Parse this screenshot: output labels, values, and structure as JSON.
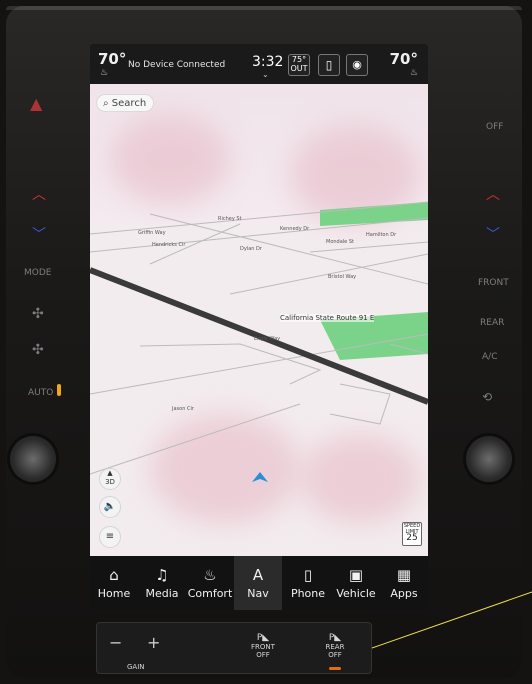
{
  "status_bar": {
    "temp_left": "70°",
    "device_status": "No Device Connected",
    "clock": "3:32",
    "outside_temp": "75°",
    "outside_label": "OUT",
    "temp_right": "70°"
  },
  "map": {
    "search_label": "Search",
    "streets": [
      "Griffin Way",
      "Richey St",
      "Kennedy Dr",
      "Mondale St",
      "Hamilton Dr",
      "Hendricks Cir",
      "Dylan Dr",
      "Bristol Way",
      "California State Route 91 E",
      "Eagle Way",
      "Jason Cir"
    ],
    "compass_label": "3D",
    "speed_limit_label": "SPEED LIMIT",
    "speed_limit_value": "25"
  },
  "nav_bar": {
    "items": [
      {
        "label": "Home",
        "icon": "home-icon"
      },
      {
        "label": "Media",
        "icon": "music-note-icon"
      },
      {
        "label": "Comfort",
        "icon": "seat-icon"
      },
      {
        "label": "Nav",
        "icon": "navigation-icon"
      },
      {
        "label": "Phone",
        "icon": "phone-icon"
      },
      {
        "label": "Vehicle",
        "icon": "vehicle-icon"
      },
      {
        "label": "Apps",
        "icon": "apps-grid-icon"
      }
    ],
    "active": "Nav",
    "accent_color": "#2e8de0"
  },
  "side_panel": {
    "left": {
      "mode": "MODE",
      "auto": "AUTO"
    },
    "right": {
      "off": "OFF",
      "front": "FRONT",
      "rear": "REAR",
      "ac": "A/C"
    }
  },
  "bottom_panel": {
    "gain_label": "GAIN",
    "front_off": "FRONT\nOFF",
    "rear_off": "REAR\nOFF"
  }
}
